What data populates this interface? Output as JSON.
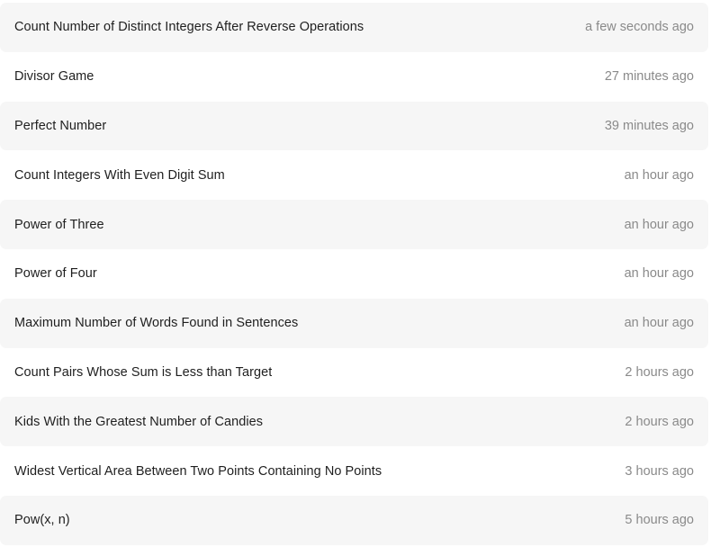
{
  "submissions": [
    {
      "title": "Count Number of Distinct Integers After Reverse Operations",
      "time": "a few seconds ago"
    },
    {
      "title": "Divisor Game",
      "time": "27 minutes ago"
    },
    {
      "title": "Perfect Number",
      "time": "39 minutes ago"
    },
    {
      "title": "Count Integers With Even Digit Sum",
      "time": "an hour ago"
    },
    {
      "title": "Power of Three",
      "time": "an hour ago"
    },
    {
      "title": "Power of Four",
      "time": "an hour ago"
    },
    {
      "title": "Maximum Number of Words Found in Sentences",
      "time": "an hour ago"
    },
    {
      "title": "Count Pairs Whose Sum is Less than Target",
      "time": "2 hours ago"
    },
    {
      "title": "Kids With the Greatest Number of Candies",
      "time": "2 hours ago"
    },
    {
      "title": "Widest Vertical Area Between Two Points Containing No Points",
      "time": "3 hours ago"
    },
    {
      "title": "Pow(x, n)",
      "time": "5 hours ago"
    }
  ],
  "colors": {
    "row_shaded": "#f6f6f6",
    "row_plain": "#ffffff",
    "title_text": "#1f1f1f",
    "time_text": "#8a8a8a"
  }
}
